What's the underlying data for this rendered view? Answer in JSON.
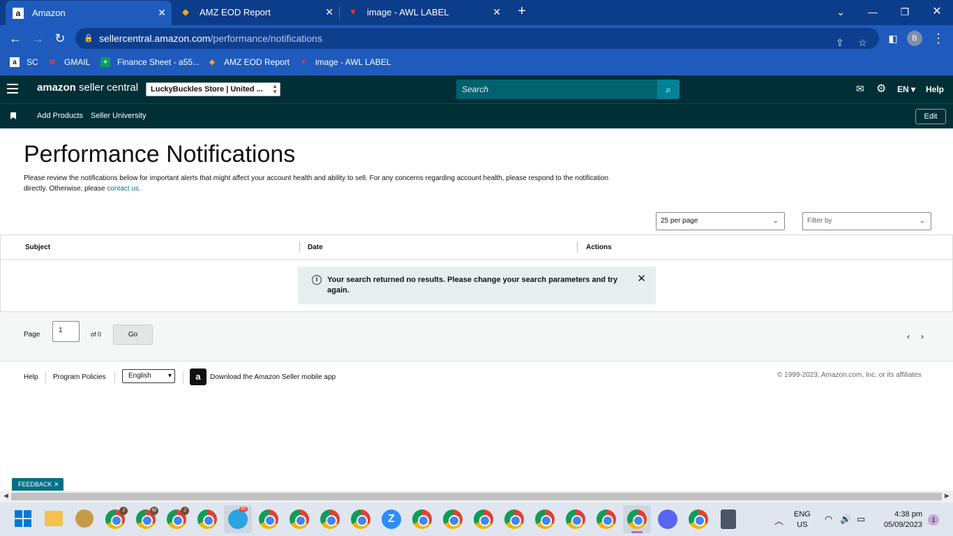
{
  "browser": {
    "tabs": [
      {
        "title": "Amazon",
        "favicon": "a",
        "active": true
      },
      {
        "title": "AMZ EOD Report",
        "favicon": "sheets-icon",
        "active": false
      },
      {
        "title": "image - AWL LABEL",
        "favicon": "awl-icon",
        "active": false
      }
    ],
    "url_host": "sellercentral.amazon.com",
    "url_path": "/performance/notifications",
    "profile_initial": "B",
    "bookmarks": [
      {
        "label": "SC",
        "icon": "a"
      },
      {
        "label": "GMAIL",
        "icon": "M"
      },
      {
        "label": "Finance Sheet - a55...",
        "icon": "+"
      },
      {
        "label": "AMZ EOD Report",
        "icon": "sheets-icon"
      },
      {
        "label": "image - AWL LABEL",
        "icon": "awl-icon"
      }
    ]
  },
  "header": {
    "logo_brand": "amazon",
    "logo_suffix": "seller central",
    "store_selector": "LuckyBuckles Store | United ...",
    "search_placeholder": "Search",
    "language": "EN",
    "help": "Help",
    "subnav": [
      "Add Products",
      "Seller University"
    ],
    "edit": "Edit"
  },
  "main": {
    "title": "Performance Notifications",
    "intro_text": "Please review the notifications below for important alerts that might affect your account health and ability to sell. For any concerns regarding account health, please respond to the notification directly. Otherwise, please",
    "intro_link": "contact us.",
    "per_page": "25 per page",
    "filter_placeholder": "Filter by",
    "columns": [
      "Subject",
      "Date",
      "Actions"
    ],
    "no_results": "Your search returned no results. Please change your search parameters and try again.",
    "pager": {
      "page_label": "Page",
      "page_value": "1",
      "of_label": "of 0",
      "go": "Go"
    }
  },
  "footer": {
    "help": "Help",
    "policies": "Program Policies",
    "language": "English",
    "app_text": "Download the Amazon Seller mobile app",
    "copyright": "© 1999-2023, Amazon.com, Inc. or its affiliates"
  },
  "feedback": "FEEDBACK",
  "taskbar": {
    "lang_line1": "ENG",
    "lang_line2": "US",
    "time": "4:38 pm",
    "date": "05/09/2023",
    "notifications": "1",
    "telegram_badge": "90"
  }
}
